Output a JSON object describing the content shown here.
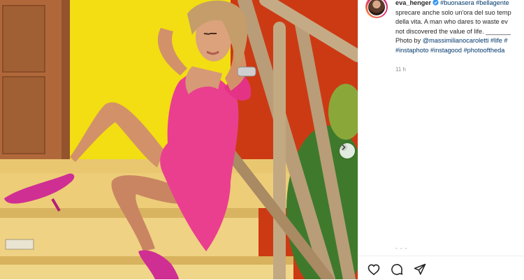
{
  "post": {
    "photo_alt": "Woman in pink dress sitting on yellow steps"
  },
  "caption": {
    "username": "eva_henger",
    "tags_line1": "#buonasera #bellagente",
    "line2": "sprecare anche solo un'ora del suo temp",
    "line3": "della vita. A man who dares to waste ev",
    "line4": "not discovered the value of life. _______",
    "line5_prefix": "Photo by ",
    "line5_mention": "@massimilianocaroletti",
    "line5_tags": " #life #",
    "line6_tags": "#instaphoto #instagood #photooftheda",
    "line7_tags": ""
  },
  "meta": {
    "time": "11 h",
    "dots": "- - -"
  },
  "colors": {
    "link": "#00376b",
    "text": "#262626",
    "muted": "#8e8e8e",
    "verified": "#3897f0"
  },
  "icons": [
    "next-arrow-icon",
    "verified-badge-icon",
    "heart-icon",
    "comment-icon",
    "share-icon"
  ]
}
